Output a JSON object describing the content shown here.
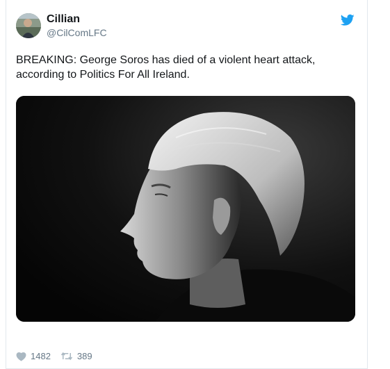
{
  "tweet": {
    "display_name": "Cillian",
    "handle": "@CilComLFC",
    "text": "BREAKING: George Soros has died of a violent heart attack, according to Politics For All Ireland.",
    "likes": "1482",
    "retweets": "389"
  },
  "icons": {
    "brand": "twitter-bird-icon",
    "like": "heart-icon",
    "retweet": "retweet-icon"
  },
  "colors": {
    "twitter_blue": "#1da1f2",
    "text": "#14171a",
    "muted": "#657786"
  }
}
